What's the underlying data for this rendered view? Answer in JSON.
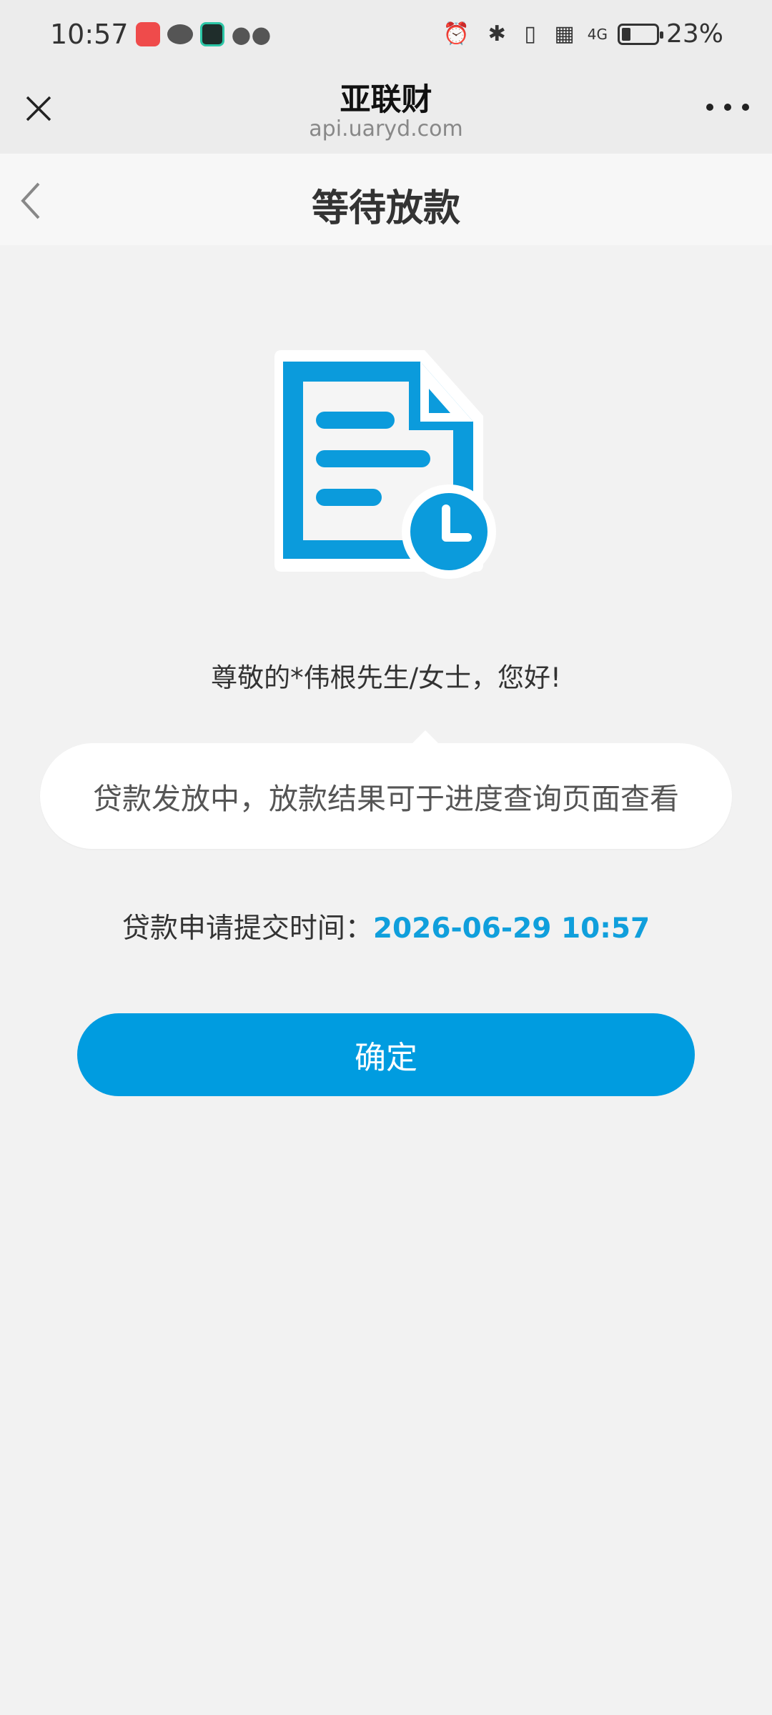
{
  "status_bar": {
    "time": "10:57",
    "battery_percent": "23%",
    "battery_level": 0.23,
    "network": "4G",
    "icons": [
      "app-icon",
      "chat-bubble-icon",
      "soul-app-icon",
      "wechat-icon",
      "alarm-icon",
      "bluetooth-icon",
      "vibrate-icon",
      "signal-icon",
      "battery-icon"
    ]
  },
  "browser": {
    "title": "亚联财",
    "url": "api.uaryd.com",
    "close_icon": "close-icon",
    "more_icon": "more-dots-icon"
  },
  "header": {
    "title": "等待放款",
    "back_icon": "back-arrow-icon"
  },
  "illustration": {
    "icon": "document-clock-icon",
    "colors": {
      "primary": "#0b9bdc",
      "accent": "#ffffff"
    }
  },
  "greeting": "尊敬的*伟根先生/女士，您好!",
  "notice": "贷款发放中，放款结果可于进度查询页面查看",
  "submit": {
    "label": "贷款申请提交时间：",
    "time": "2026-06-29 10:57"
  },
  "confirm_button": "确定",
  "colors": {
    "brand": "#009ce0",
    "time_text": "#109fdc",
    "background": "#f2f2f2"
  }
}
